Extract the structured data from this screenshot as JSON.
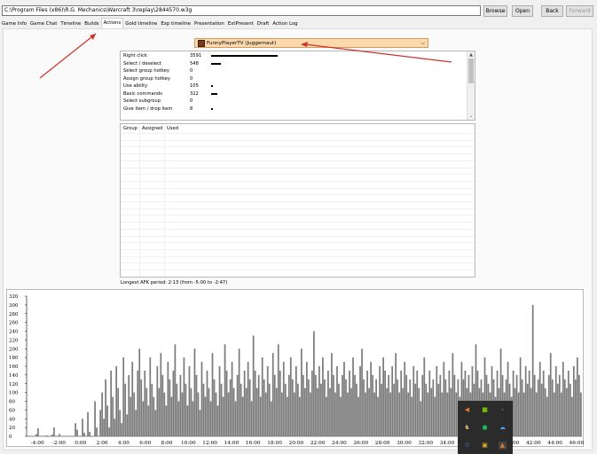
{
  "toolbar": {
    "path": "C:\\Program Files (x86)\\R.G. Mechanics\\Warcraft 3\\replay\\2844570.w3g",
    "browse_label": "Browse",
    "open_label": "Open",
    "back_label": "Back",
    "forward_label": "Forward"
  },
  "tabs": [
    {
      "label": "Game Info"
    },
    {
      "label": "Game Chat"
    },
    {
      "label": "Timeline"
    },
    {
      "label": "Builds"
    },
    {
      "label": "Actions",
      "active": true
    },
    {
      "label": "Gold timeline"
    },
    {
      "label": "Exp timeline"
    },
    {
      "label": "Presentation"
    },
    {
      "label": "ExtPresent"
    },
    {
      "label": "Draft"
    },
    {
      "label": "Action Log"
    }
  ],
  "player_select": {
    "selected": "FunnyPlayerTV (Juggernaut)",
    "icon": "juggernaut-hero-icon",
    "highlight_color": "#fcd9ad"
  },
  "actions": [
    {
      "name": "Right click",
      "count": "3591"
    },
    {
      "name": "Select / deselect",
      "count": "548"
    },
    {
      "name": "Select group hotkey",
      "count": "0"
    },
    {
      "name": "Assign group hotkey",
      "count": "0"
    },
    {
      "name": "Use ability",
      "count": "105"
    },
    {
      "name": "Basic commands",
      "count": "322"
    },
    {
      "name": "Select subgroup",
      "count": "0"
    },
    {
      "name": "Give item / drop item",
      "count": "8"
    }
  ],
  "hotkey_table": {
    "columns": [
      "Group",
      "Assigned",
      "Used"
    ]
  },
  "afk_text": "Longest AFK period: 2:13 (from -5:00 to -2:47)",
  "annotation_color": "#d0312d",
  "chart_data": {
    "type": "bar",
    "xlabel": "",
    "ylabel": "",
    "ylim": [
      0,
      320
    ],
    "y_ticks": [
      "0",
      "20",
      "40",
      "60",
      "80",
      "100",
      "120",
      "140",
      "160",
      "180",
      "200",
      "220",
      "240",
      "260",
      "280",
      "300",
      "320"
    ],
    "x_ticks": [
      "-4:00",
      "-2:00",
      "0:00",
      "2:00",
      "4:00",
      "6:00",
      "8:00",
      "10:00",
      "12:00",
      "14:00",
      "16:00",
      "18:00",
      "20:00",
      "22:00",
      "24:00",
      "26:00",
      "28:00",
      "30:00",
      "32:00",
      "34:00",
      "36:00",
      "38:00",
      "40:00",
      "42:00",
      "44:00",
      "46:00"
    ],
    "x_range": [
      -5,
      46.5
    ],
    "values": [
      0,
      0,
      0,
      0,
      0,
      5,
      18,
      0,
      0,
      0,
      0,
      2,
      0,
      0,
      4,
      20,
      0,
      0,
      5,
      0,
      0,
      0,
      0,
      0,
      0,
      0,
      0,
      30,
      15,
      0,
      0,
      40,
      8,
      0,
      55,
      10,
      0,
      0,
      80,
      20,
      0,
      60,
      100,
      40,
      130,
      70,
      20,
      150,
      90,
      40,
      160,
      110,
      60,
      30,
      180,
      120,
      50,
      140,
      90,
      170,
      100,
      60,
      150,
      200,
      130,
      80,
      150,
      110,
      70,
      180,
      120,
      90,
      60,
      160,
      110,
      190,
      140,
      100,
      70,
      170,
      130,
      90,
      150,
      210,
      120,
      80,
      140,
      100,
      180,
      120,
      70,
      160,
      110,
      80,
      200,
      140,
      100,
      60,
      170,
      120,
      90,
      150,
      110,
      80,
      190,
      130,
      100,
      70,
      160,
      120,
      90,
      210,
      150,
      100,
      130,
      170,
      110,
      80,
      140,
      200,
      120,
      90,
      150,
      110,
      170,
      130,
      80,
      230,
      150,
      110,
      140,
      90,
      180,
      130,
      100,
      160,
      120,
      80,
      190,
      140,
      110,
      210,
      150,
      100,
      170,
      120,
      90,
      140,
      180,
      130,
      100,
      160,
      120,
      90,
      200,
      140,
      110,
      170,
      130,
      100,
      150,
      240,
      140,
      110,
      160,
      120,
      180,
      130,
      90,
      150,
      110,
      190,
      140,
      100,
      160,
      120,
      90,
      140,
      170,
      130,
      100,
      150,
      110,
      180,
      140,
      120,
      90,
      160,
      200,
      130,
      100,
      150,
      110,
      170,
      140,
      100,
      130,
      90,
      160,
      120,
      180,
      150,
      110,
      140,
      100,
      160,
      120,
      190,
      130,
      100,
      150,
      110,
      170,
      140,
      100,
      130,
      90,
      160,
      120,
      150,
      110,
      80,
      140,
      180,
      120,
      100,
      150,
      110,
      130,
      90,
      160,
      120,
      140,
      100,
      170,
      130,
      100,
      150,
      110,
      190,
      140,
      100,
      130,
      90,
      170,
      130,
      150,
      110,
      140,
      100,
      160,
      120,
      210,
      150,
      110,
      130,
      100,
      180,
      140,
      120,
      100,
      160,
      130,
      90,
      150,
      110,
      200,
      140,
      100,
      130,
      170,
      120,
      90,
      150,
      110,
      140,
      100,
      180,
      130,
      100,
      160,
      120,
      150,
      110,
      300,
      140,
      100,
      130,
      170,
      120,
      150,
      110,
      90,
      140,
      190,
      130,
      100,
      160,
      120,
      140,
      100,
      170,
      130,
      110,
      150,
      120,
      90,
      160,
      130,
      180,
      140,
      100
    ]
  }
}
